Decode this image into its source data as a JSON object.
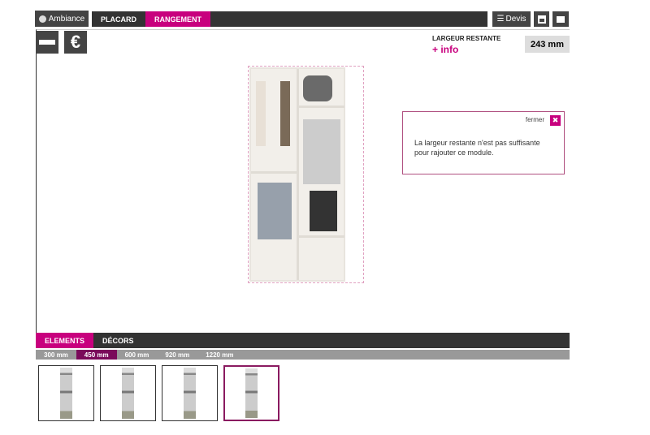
{
  "header": {
    "ambiance_label": "Ambiance",
    "tabs": [
      {
        "label": "PLACARD",
        "active": false
      },
      {
        "label": "RANGEMENT",
        "active": true
      }
    ],
    "devis_label": "Devis",
    "save_icon": "floppy-disk-icon",
    "comment_icon": "speech-bubble-icon"
  },
  "toolbar": {
    "minus_icon": "minus-icon",
    "euro_label": "€"
  },
  "info": {
    "title": "LARGEUR RESTANTE",
    "link": "+ info",
    "value": "243 mm"
  },
  "popup": {
    "close_label": "fermer",
    "message": "La largeur restante n'est pas suffisante pour rajouter ce module."
  },
  "bottom": {
    "tabs": [
      {
        "label": "ELEMENTS",
        "active": true
      },
      {
        "label": "DÉCORS",
        "active": false
      }
    ],
    "sizes": [
      {
        "label": "300 mm",
        "active": false
      },
      {
        "label": "450 mm",
        "active": true
      },
      {
        "label": "600 mm",
        "active": false
      },
      {
        "label": "920 mm",
        "active": false
      },
      {
        "label": "1220 mm",
        "active": false
      }
    ],
    "selected_thumbnail": 4
  },
  "colors": {
    "accent": "#c8007e",
    "dark": "#333333"
  }
}
